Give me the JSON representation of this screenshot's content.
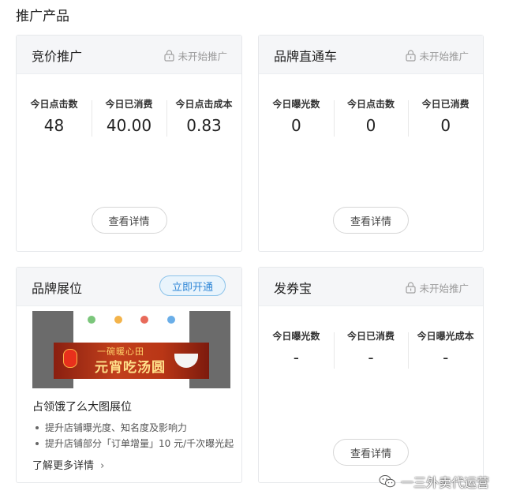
{
  "page_title": "推广产品",
  "cards": {
    "bidding": {
      "title": "竞价推广",
      "status": "未开始推广",
      "metrics": [
        {
          "label": "今日点击数",
          "value": "48"
        },
        {
          "label": "今日已消费",
          "value": "40.00"
        },
        {
          "label": "今日点击成本",
          "value": "0.83"
        }
      ],
      "details_label": "查看详情"
    },
    "brand_express": {
      "title": "品牌直通车",
      "status": "未开始推广",
      "metrics": [
        {
          "label": "今日曝光数",
          "value": "0"
        },
        {
          "label": "今日点击数",
          "value": "0"
        },
        {
          "label": "今日已消费",
          "value": "0"
        }
      ],
      "details_label": "查看详情"
    },
    "brand_showcase": {
      "title": "品牌展位",
      "open_label": "立即开通",
      "banner": {
        "line1": "一碗暖心田",
        "line2": "元宵吃汤圆"
      },
      "promo_title": "占领饿了么大图展位",
      "bullets": [
        "提升店铺曝光度、知名度及影响力",
        "提升店铺部分「订单增量」10 元/千次曝光起"
      ],
      "more_label": "了解更多详情"
    },
    "coupon": {
      "title": "发券宝",
      "status": "未开始推广",
      "metrics": [
        {
          "label": "今日曝光数",
          "value": "-"
        },
        {
          "label": "今日已消费",
          "value": "-"
        },
        {
          "label": "今日曝光成本",
          "value": "-"
        }
      ],
      "details_label": "查看详情"
    }
  },
  "watermark": {
    "text": "一三外卖代运营",
    "icon": "wechat-icon"
  },
  "colors": {
    "accent_blue": "#2f86d6",
    "header_bg": "#f5f6f8",
    "muted": "#9a9a9a"
  }
}
